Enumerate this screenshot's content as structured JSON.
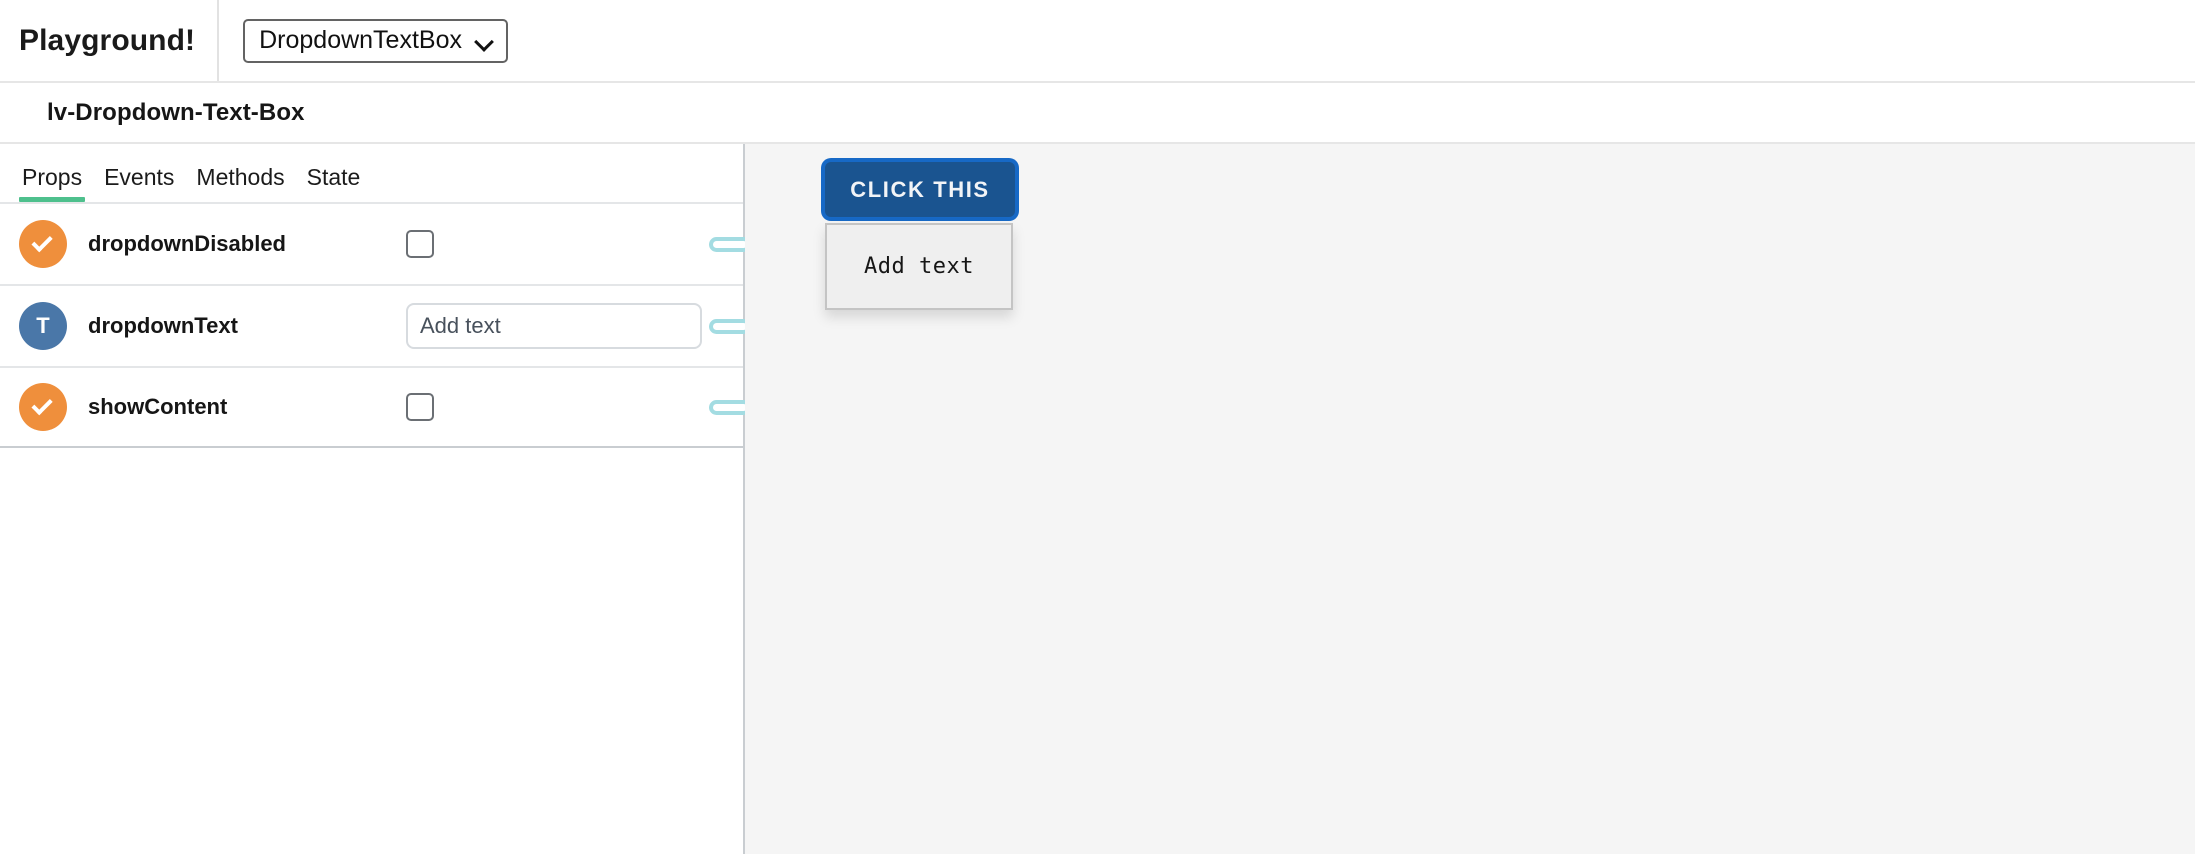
{
  "header": {
    "app_title": "Playground!",
    "component_select": {
      "selected": "DropdownTextBox",
      "chevron_icon": "chevron-down-icon"
    }
  },
  "component": {
    "name": "lv-Dropdown-Text-Box"
  },
  "tabs": [
    {
      "label": "Props",
      "active": true
    },
    {
      "label": "Events",
      "active": false
    },
    {
      "label": "Methods",
      "active": false
    },
    {
      "label": "State",
      "active": false
    }
  ],
  "props": [
    {
      "name": "dropdownDisabled",
      "type": "boolean",
      "type_badge_glyph": "check-icon",
      "control": "checkbox",
      "checked": false,
      "link_icon": "link-pill-icon"
    },
    {
      "name": "dropdownText",
      "type": "text",
      "type_badge_glyph": "T",
      "control": "text-input",
      "value": "",
      "placeholder": "Add text",
      "link_icon": "link-pill-icon"
    },
    {
      "name": "showContent",
      "type": "boolean",
      "type_badge_glyph": "check-icon",
      "control": "checkbox",
      "checked": false,
      "link_icon": "link-pill-icon"
    }
  ],
  "preview": {
    "button_label": "CLICK THIS",
    "dropdown_content": "Add text"
  },
  "colors": {
    "accent_tab": "#4ec08d",
    "badge_boolean": "#ef8f3c",
    "badge_text": "#4a77a8",
    "button_fill": "#1a5490",
    "button_focus_ring": "#1769c6",
    "link_pill": "#a3dce2",
    "stage_background": "#f5f5f5"
  }
}
